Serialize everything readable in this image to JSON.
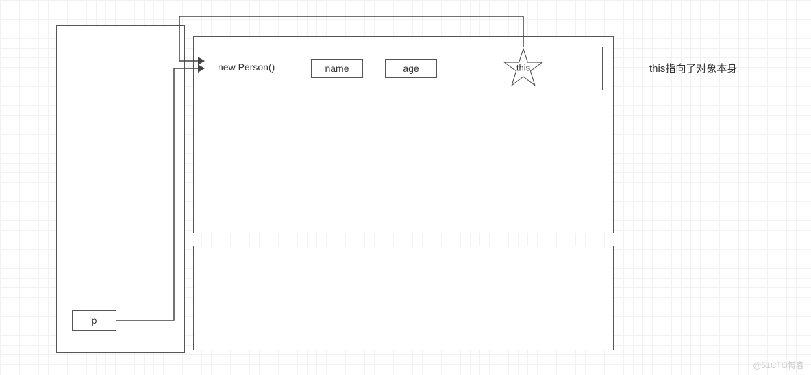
{
  "left_box": {
    "p_label": "p"
  },
  "object_row": {
    "new_label": "new Person()",
    "field1": "name",
    "field2": "age",
    "this_label": "this"
  },
  "annotation": "this指向了对象本身",
  "watermark": "@51CTO博客",
  "chart_data": {
    "type": "diagram",
    "description": "Memory/reference diagram: variable p points to a new Person() object. The object has fields name, age, and an implicit 'this' reference (star) that points back to the object itself.",
    "nodes": [
      {
        "id": "p",
        "label": "p",
        "kind": "variable"
      },
      {
        "id": "person",
        "label": "new Person()",
        "kind": "object",
        "fields": [
          "name",
          "age",
          "this"
        ]
      },
      {
        "id": "heap_block_2",
        "label": "",
        "kind": "object"
      }
    ],
    "edges": [
      {
        "from": "p",
        "to": "person",
        "meaning": "reference"
      },
      {
        "from": "this",
        "to": "person",
        "meaning": "self-reference",
        "note": "this指向了对象本身"
      }
    ]
  }
}
